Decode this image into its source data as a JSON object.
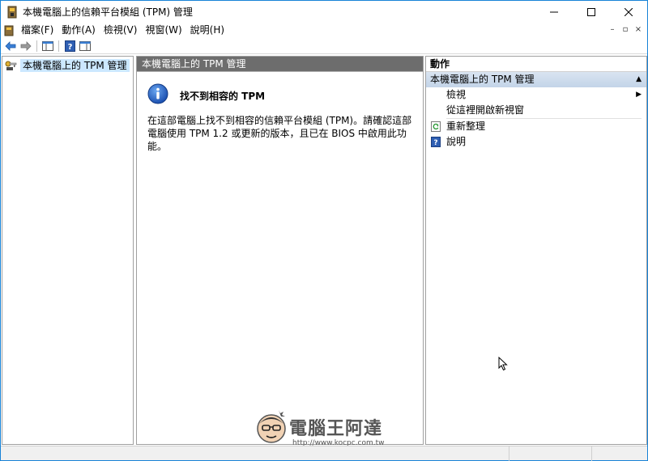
{
  "window": {
    "title": "本機電腦上的信賴平台模組 (TPM) 管理",
    "controls": {
      "minimize": "—",
      "maximize": "☐",
      "close": "✕"
    }
  },
  "menubar": {
    "items": [
      "檔案(F)",
      "動作(A)",
      "檢視(V)",
      "視窗(W)",
      "說明(H)"
    ],
    "mdi_controls": [
      "–",
      "▫",
      "×"
    ]
  },
  "toolbar": {
    "buttons": [
      "back-arrow-icon",
      "forward-arrow-icon",
      "show-hide-console-tree-icon",
      "help-icon",
      "show-hide-action-pane-icon"
    ]
  },
  "tree": {
    "selected_item": "本機電腦上的 TPM 管理"
  },
  "center": {
    "header": "本機電腦上的 TPM 管理",
    "notfound_title": "找不到相容的 TPM",
    "message": "在這部電腦上找不到相容的信賴平台模組 (TPM)。請確認這部電腦使用 TPM 1.2 或更新的版本，且已在 BIOS 中啟用此功能。"
  },
  "actions": {
    "header": "動作",
    "group_title": "本機電腦上的 TPM 管理",
    "items": [
      {
        "label": "檢視",
        "icon": "",
        "has_submenu": true
      },
      {
        "label": "從這裡開啟新視窗",
        "icon": "",
        "has_submenu": false
      },
      {
        "label": "重新整理",
        "icon": "refresh-icon",
        "has_submenu": false
      },
      {
        "label": "說明",
        "icon": "help-icon",
        "has_submenu": false
      }
    ]
  },
  "watermark": {
    "text": "電腦王阿達",
    "url": "http://www.kocpc.com.tw"
  },
  "colors": {
    "window_border": "#1883d7",
    "pane_header": "#6d6d6d",
    "tree_selection": "#cce8ff",
    "actions_group": "#c3d4e8"
  }
}
